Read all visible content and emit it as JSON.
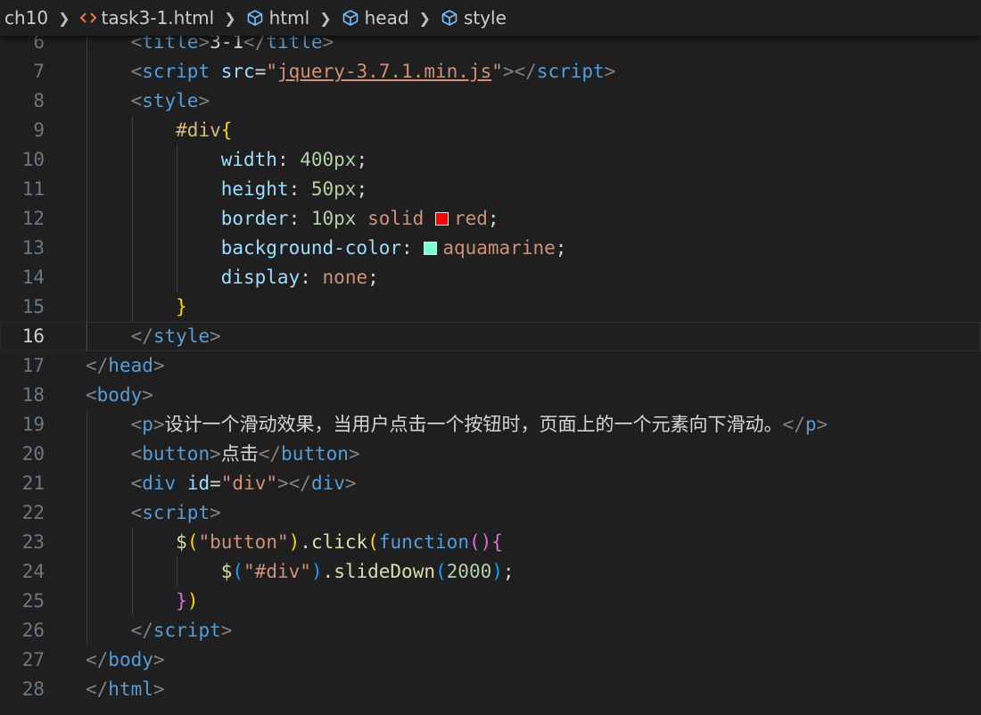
{
  "breadcrumb": {
    "items": [
      {
        "label": "ch10",
        "icon": ""
      },
      {
        "label": "task3-1.html",
        "icon": "html-file-icon"
      },
      {
        "label": "html",
        "icon": "symbol-element-icon"
      },
      {
        "label": "head",
        "icon": "symbol-element-icon"
      },
      {
        "label": "style",
        "icon": "symbol-element-icon"
      }
    ]
  },
  "colors": {
    "swatch_red": "#ff0000",
    "swatch_aquamarine": "#7fffd4",
    "background": "#1f1f1f",
    "html_icon": "#e37933",
    "element_icon": "#75beff"
  },
  "editor": {
    "current_line": "16",
    "lines": [
      {
        "n": "6",
        "indent": "    ",
        "tokens": [
          [
            "t-punct",
            "<"
          ],
          [
            "t-tag",
            "title"
          ],
          [
            "t-punct",
            ">"
          ],
          [
            "t-text",
            "3-1"
          ],
          [
            "t-punct",
            "</"
          ],
          [
            "t-tag",
            "title"
          ],
          [
            "t-punct",
            ">"
          ]
        ]
      },
      {
        "n": "7",
        "indent": "    ",
        "tokens": [
          [
            "t-punct",
            "<"
          ],
          [
            "t-tag",
            "script"
          ],
          [
            "t-text",
            " "
          ],
          [
            "t-attr",
            "src"
          ],
          [
            "t-text",
            "="
          ],
          [
            "t-str",
            "\""
          ],
          [
            "t-link",
            "jquery-3.7.1.min.js"
          ],
          [
            "t-str",
            "\""
          ],
          [
            "t-punct",
            "></"
          ],
          [
            "t-tag",
            "script"
          ],
          [
            "t-punct",
            ">"
          ]
        ]
      },
      {
        "n": "8",
        "indent": "    ",
        "tokens": [
          [
            "t-punct",
            "<"
          ],
          [
            "t-tag",
            "style"
          ],
          [
            "t-punct",
            ">"
          ]
        ]
      },
      {
        "n": "9",
        "indent": "        ",
        "tokens": [
          [
            "t-sel",
            "#div"
          ],
          [
            "t-brace",
            "{"
          ]
        ]
      },
      {
        "n": "10",
        "indent": "            ",
        "tokens": [
          [
            "t-attr",
            "width"
          ],
          [
            "t-text",
            ": "
          ],
          [
            "t-num",
            "400px"
          ],
          [
            "t-text",
            ";"
          ]
        ]
      },
      {
        "n": "11",
        "indent": "            ",
        "tokens": [
          [
            "t-attr",
            "height"
          ],
          [
            "t-text",
            ": "
          ],
          [
            "t-num",
            "50px"
          ],
          [
            "t-text",
            ";"
          ]
        ]
      },
      {
        "n": "12",
        "indent": "            ",
        "tokens": [
          [
            "t-attr",
            "border"
          ],
          [
            "t-text",
            ": "
          ],
          [
            "t-num",
            "10px"
          ],
          [
            "t-text",
            " "
          ],
          [
            "t-val",
            "solid"
          ],
          [
            "t-text",
            " "
          ],
          [
            "swatch",
            "#ff0000"
          ],
          [
            "t-val",
            "red"
          ],
          [
            "t-text",
            ";"
          ]
        ]
      },
      {
        "n": "13",
        "indent": "            ",
        "tokens": [
          [
            "t-attr",
            "background-color"
          ],
          [
            "t-text",
            ": "
          ],
          [
            "swatch",
            "#7fffd4"
          ],
          [
            "t-val",
            "aquamarine"
          ],
          [
            "t-text",
            ";"
          ]
        ]
      },
      {
        "n": "14",
        "indent": "            ",
        "tokens": [
          [
            "t-attr",
            "display"
          ],
          [
            "t-text",
            ": "
          ],
          [
            "t-val",
            "none"
          ],
          [
            "t-text",
            ";"
          ]
        ]
      },
      {
        "n": "15",
        "indent": "        ",
        "tokens": [
          [
            "t-brace",
            "}"
          ]
        ]
      },
      {
        "n": "16",
        "indent": "    ",
        "tokens": [
          [
            "t-punct",
            "</"
          ],
          [
            "t-tag",
            "style"
          ],
          [
            "t-punct",
            ">"
          ]
        ]
      },
      {
        "n": "17",
        "indent": "",
        "tokens": [
          [
            "t-punct",
            "</"
          ],
          [
            "t-tag",
            "head"
          ],
          [
            "t-punct",
            ">"
          ]
        ]
      },
      {
        "n": "18",
        "indent": "",
        "tokens": [
          [
            "t-punct",
            "<"
          ],
          [
            "t-tag",
            "body"
          ],
          [
            "t-punct",
            ">"
          ]
        ]
      },
      {
        "n": "19",
        "indent": "    ",
        "tokens": [
          [
            "t-punct",
            "<"
          ],
          [
            "t-tag",
            "p"
          ],
          [
            "t-punct",
            ">"
          ],
          [
            "t-cjk",
            "设计一个滑动效果，当用户点击一个按钮时，页面上的一个元素向下滑动。"
          ],
          [
            "t-punct",
            "</"
          ],
          [
            "t-tag",
            "p"
          ],
          [
            "t-punct",
            ">"
          ]
        ]
      },
      {
        "n": "20",
        "indent": "    ",
        "tokens": [
          [
            "t-punct",
            "<"
          ],
          [
            "t-tag",
            "button"
          ],
          [
            "t-punct",
            ">"
          ],
          [
            "t-cjk",
            "点击"
          ],
          [
            "t-punct",
            "</"
          ],
          [
            "t-tag",
            "button"
          ],
          [
            "t-punct",
            ">"
          ]
        ]
      },
      {
        "n": "21",
        "indent": "    ",
        "tokens": [
          [
            "t-punct",
            "<"
          ],
          [
            "t-tag",
            "div"
          ],
          [
            "t-text",
            " "
          ],
          [
            "t-attr",
            "id"
          ],
          [
            "t-text",
            "="
          ],
          [
            "t-str",
            "\"div\""
          ],
          [
            "t-punct",
            "></"
          ],
          [
            "t-tag",
            "div"
          ],
          [
            "t-punct",
            ">"
          ]
        ]
      },
      {
        "n": "22",
        "indent": "    ",
        "tokens": [
          [
            "t-punct",
            "<"
          ],
          [
            "t-tag",
            "script"
          ],
          [
            "t-punct",
            ">"
          ]
        ]
      },
      {
        "n": "23",
        "indent": "        ",
        "tokens": [
          [
            "t-fn",
            "$"
          ],
          [
            "t-brace",
            "("
          ],
          [
            "t-str",
            "\"button\""
          ],
          [
            "t-brace",
            ")"
          ],
          [
            "t-text",
            "."
          ],
          [
            "t-fn",
            "click"
          ],
          [
            "t-brace",
            "("
          ],
          [
            "t-kw",
            "function"
          ],
          [
            "t-brace2",
            "()"
          ],
          [
            "t-brace2",
            "{"
          ]
        ]
      },
      {
        "n": "24",
        "indent": "            ",
        "tokens": [
          [
            "t-fn",
            "$"
          ],
          [
            "t-brace3",
            "("
          ],
          [
            "t-str",
            "\"#div\""
          ],
          [
            "t-brace3",
            ")"
          ],
          [
            "t-text",
            "."
          ],
          [
            "t-fn",
            "slideDown"
          ],
          [
            "t-brace3",
            "("
          ],
          [
            "t-num",
            "2000"
          ],
          [
            "t-brace3",
            ")"
          ],
          [
            "t-text",
            ";"
          ]
        ]
      },
      {
        "n": "25",
        "indent": "        ",
        "tokens": [
          [
            "t-brace2",
            "}"
          ],
          [
            "t-brace",
            ")"
          ]
        ]
      },
      {
        "n": "26",
        "indent": "    ",
        "tokens": [
          [
            "t-punct",
            "</"
          ],
          [
            "t-tag",
            "script"
          ],
          [
            "t-punct",
            ">"
          ]
        ]
      },
      {
        "n": "27",
        "indent": "",
        "tokens": [
          [
            "t-punct",
            "</"
          ],
          [
            "t-tag",
            "body"
          ],
          [
            "t-punct",
            ">"
          ]
        ]
      },
      {
        "n": "28",
        "indent": "",
        "tokens": [
          [
            "t-punct",
            "</"
          ],
          [
            "t-tag",
            "html"
          ],
          [
            "t-punct",
            ">"
          ]
        ]
      }
    ]
  }
}
